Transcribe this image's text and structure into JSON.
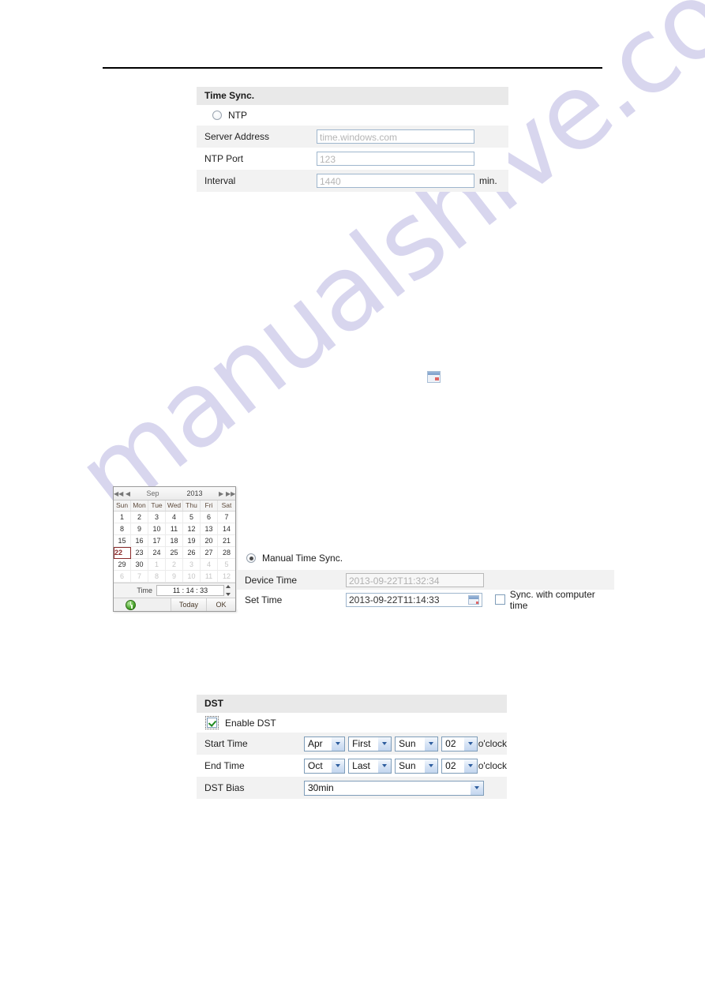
{
  "watermark": {
    "text": "manualshive.com"
  },
  "time_sync_panel": {
    "header": "Time Sync.",
    "ntp_option": {
      "label": "NTP",
      "checked": false
    },
    "rows": [
      {
        "label": "Server Address",
        "value": "time.windows.com",
        "unit": ""
      },
      {
        "label": "NTP Port",
        "value": "123",
        "unit": ""
      },
      {
        "label": "Interval",
        "value": "1440",
        "unit": "min."
      }
    ]
  },
  "calendar": {
    "nav": {
      "prev_year": "◀◀",
      "prev_month": "◀",
      "next_month": "▶",
      "next_year": "▶▶"
    },
    "month": "Sep",
    "year": "2013",
    "weekdays": [
      "Sun",
      "Mon",
      "Tue",
      "Wed",
      "Thu",
      "Fri",
      "Sat"
    ],
    "days": [
      {
        "d": "1"
      },
      {
        "d": "2"
      },
      {
        "d": "3"
      },
      {
        "d": "4"
      },
      {
        "d": "5"
      },
      {
        "d": "6"
      },
      {
        "d": "7"
      },
      {
        "d": "8"
      },
      {
        "d": "9"
      },
      {
        "d": "10"
      },
      {
        "d": "11"
      },
      {
        "d": "12"
      },
      {
        "d": "13"
      },
      {
        "d": "14"
      },
      {
        "d": "15"
      },
      {
        "d": "16"
      },
      {
        "d": "17"
      },
      {
        "d": "18"
      },
      {
        "d": "19"
      },
      {
        "d": "20"
      },
      {
        "d": "21"
      },
      {
        "d": "22",
        "state": "selected"
      },
      {
        "d": "23"
      },
      {
        "d": "24"
      },
      {
        "d": "25"
      },
      {
        "d": "26"
      },
      {
        "d": "27"
      },
      {
        "d": "28"
      },
      {
        "d": "29"
      },
      {
        "d": "30"
      },
      {
        "d": "1",
        "state": "out"
      },
      {
        "d": "2",
        "state": "out"
      },
      {
        "d": "3",
        "state": "out"
      },
      {
        "d": "4",
        "state": "out"
      },
      {
        "d": "5",
        "state": "out"
      },
      {
        "d": "6",
        "state": "out"
      },
      {
        "d": "7",
        "state": "out"
      },
      {
        "d": "8",
        "state": "out"
      },
      {
        "d": "9",
        "state": "out"
      },
      {
        "d": "10",
        "state": "out"
      },
      {
        "d": "11",
        "state": "out"
      },
      {
        "d": "12",
        "state": "out"
      }
    ],
    "time_label": "Time",
    "time_value": "11 :  14  :  33",
    "today_button": "Today",
    "ok_button": "OK"
  },
  "manual_sync": {
    "option_label": "Manual Time Sync.",
    "option_checked": true,
    "device_time": {
      "label": "Device Time",
      "value": "2013-09-22T11:32:34"
    },
    "set_time": {
      "label": "Set Time",
      "value": "2013-09-22T11:14:33"
    },
    "sync_checkbox": {
      "label": "Sync. with computer time",
      "checked": false
    }
  },
  "dst_panel": {
    "header": "DST",
    "enable": {
      "label": "Enable DST",
      "checked": true
    },
    "start_time": {
      "label": "Start Time",
      "month": "Apr",
      "week": "First",
      "day": "Sun",
      "hour": "02",
      "unit": "o'clock"
    },
    "end_time": {
      "label": "End Time",
      "month": "Oct",
      "week": "Last",
      "day": "Sun",
      "hour": "02",
      "unit": "o'clock"
    },
    "dst_bias": {
      "label": "DST Bias",
      "value": "30min"
    }
  }
}
